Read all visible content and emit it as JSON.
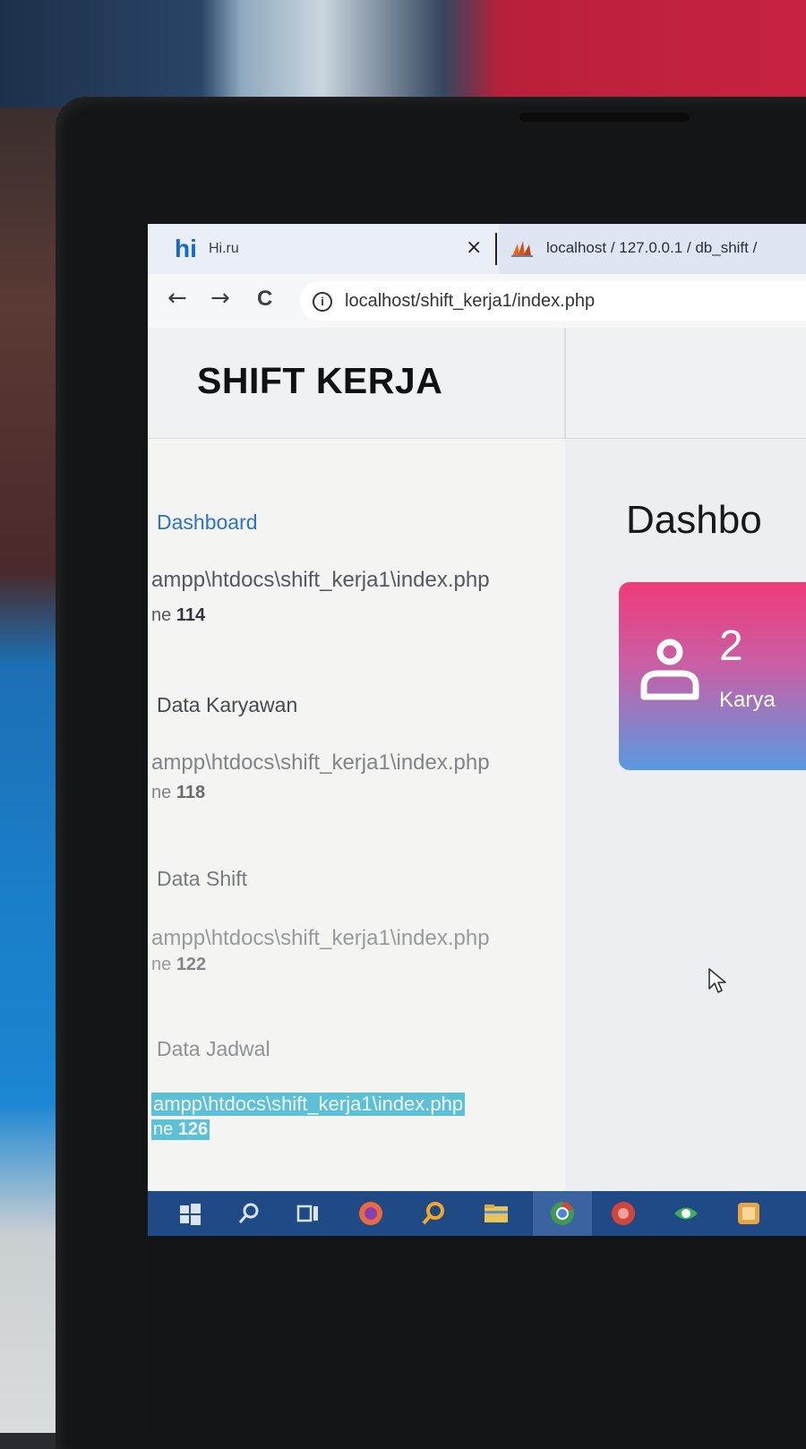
{
  "browser": {
    "tab_active": {
      "logo": "hi",
      "title": "Hi.ru",
      "close": "×"
    },
    "tab_second": {
      "title": "localhost / 127.0.0.1 / db_shift /"
    },
    "nav": {
      "back": "←",
      "forward": "→",
      "reload": "C"
    },
    "address": {
      "info": "i",
      "url": "localhost/shift_kerja1/index.php"
    }
  },
  "app": {
    "brand": "SHIFT KERJA",
    "sidebar": {
      "items": [
        {
          "label": "Dashboard",
          "path": "ampp\\htdocs\\shift_kerja1\\index.php",
          "line_prefix": "ne ",
          "line_no": "114",
          "active": true
        },
        {
          "label": "Data Karyawan",
          "path": "ampp\\htdocs\\shift_kerja1\\index.php",
          "line_prefix": "ne ",
          "line_no": "118",
          "active": false
        },
        {
          "label": "Data Shift",
          "path": "ampp\\htdocs\\shift_kerja1\\index.php",
          "line_prefix": "ne ",
          "line_no": "122",
          "active": false
        },
        {
          "label": "Data Jadwal",
          "path": "ampp\\htdocs\\shift_kerja1\\index.php",
          "line_prefix": "ne ",
          "line_no": "126",
          "active": false
        }
      ]
    },
    "main": {
      "title": "Dashbo",
      "card": {
        "value": "2",
        "label": "Karya"
      }
    }
  },
  "taskbar": {
    "icons": [
      "windows-start-icon",
      "search-icon",
      "task-view-icon",
      "firefox-icon",
      "search-app-icon",
      "file-explorer-icon",
      "chrome-icon",
      "app-red-icon",
      "app-green-icon",
      "app-yellow-icon"
    ]
  },
  "colors": {
    "accent_blue": "#2a73c9",
    "card_top": "#ef3b78",
    "card_bottom": "#5a9ae0",
    "selection": "#5cc0d6",
    "taskbar": "#1f4a86"
  }
}
